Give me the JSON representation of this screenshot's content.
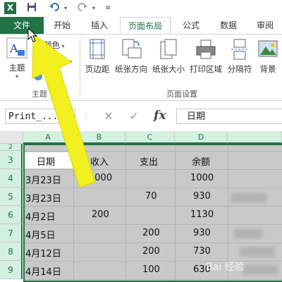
{
  "quick_access": {
    "logo": "X",
    "save_icon": "floppy-disk",
    "undo_icon": "undo-arrow",
    "redo_icon": "redo-arrow"
  },
  "tabs": [
    {
      "label": "文件"
    },
    {
      "label": "开始"
    },
    {
      "label": "插入"
    },
    {
      "label": "页面布局"
    },
    {
      "label": "公式"
    },
    {
      "label": "数据"
    },
    {
      "label": "审阅"
    }
  ],
  "ribbon": {
    "theme_group": {
      "label": "主题",
      "theme_button": "主题",
      "colors": "颜色",
      "fonts": "体",
      "effects": ""
    },
    "page_setup_group": {
      "label": "页面设置",
      "buttons": [
        "页边距",
        "纸张方向",
        "纸张大小",
        "打印区域",
        "分隔符",
        "背景"
      ]
    }
  },
  "formula_bar": {
    "name_box": "Print_...",
    "cancel_symbol": "✕",
    "enter_symbol": "✓",
    "fx": "fx",
    "content": "日期"
  },
  "sheet": {
    "columns": [
      "A",
      "B",
      "C",
      "D"
    ],
    "partial_row": "2",
    "rows": [
      {
        "num": "3",
        "cells": [
          "日期",
          "收入",
          "支出",
          "余额"
        ]
      },
      {
        "num": "4",
        "cells": [
          "3月23日",
          "1000",
          "",
          "1000"
        ]
      },
      {
        "num": "5",
        "cells": [
          "3月23日",
          "",
          "70",
          "930"
        ]
      },
      {
        "num": "6",
        "cells": [
          "4月2日",
          "200",
          "",
          "1130"
        ]
      },
      {
        "num": "7",
        "cells": [
          "4月5日",
          "",
          "200",
          "930"
        ]
      },
      {
        "num": "8",
        "cells": [
          "4月12日",
          "",
          "200",
          "730"
        ]
      },
      {
        "num": "9",
        "cells": [
          "4月14日",
          "",
          "100",
          "630"
        ]
      }
    ]
  },
  "colors": {
    "excel_green": "#217346",
    "arrow_yellow": "#f2f01e",
    "selection_gray": "#c9c9c9"
  },
  "watermark": "Bai 经验"
}
